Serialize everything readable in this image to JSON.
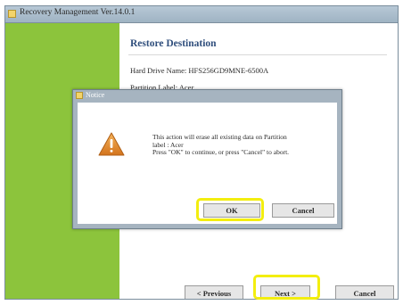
{
  "window": {
    "title": "Recovery Management Ver.14.0.1"
  },
  "page": {
    "heading": "Restore Destination",
    "hard_drive": "Hard Drive Name: HFS256GD9MNE-6500A",
    "partition": "Partition Label: Acer"
  },
  "buttons": {
    "previous": "< Previous",
    "next": "Next >",
    "cancel": "Cancel"
  },
  "dialog": {
    "title": "Notice",
    "icon": "warning-icon",
    "message_lines": [
      "This action will erase all existing data on Partition",
      "label : Acer",
      "Press \"OK\" to continue, or press \"Cancel\" to abort."
    ],
    "ok": "OK",
    "cancel": "Cancel"
  },
  "colors": {
    "sidebar": "#8cc43c",
    "heading": "#2f4e7c",
    "highlight": "#f3ee0f",
    "warning": "#e08a2a"
  }
}
